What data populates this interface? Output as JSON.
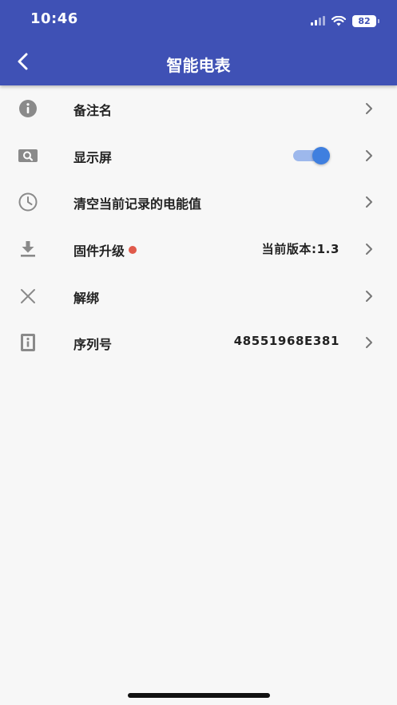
{
  "status_bar": {
    "time": "10:46",
    "battery": "82"
  },
  "header": {
    "title": "智能电表"
  },
  "rows": [
    {
      "label": "备注名",
      "icon": "info-icon"
    },
    {
      "label": "显示屏",
      "icon": "screen-search-icon",
      "toggle_on": true
    },
    {
      "label": "清空当前记录的电能值",
      "icon": "clock-icon"
    },
    {
      "label": "固件升级",
      "icon": "download-icon",
      "value": "当前版本:1.3",
      "has_badge": true
    },
    {
      "label": "解绑",
      "icon": "close-icon"
    },
    {
      "label": "序列号",
      "icon": "info-box-icon",
      "value": "48551968E381"
    }
  ],
  "colors": {
    "header": "#3f51b5",
    "accent": "#3f7fdf",
    "badge": "#e05a4b"
  }
}
